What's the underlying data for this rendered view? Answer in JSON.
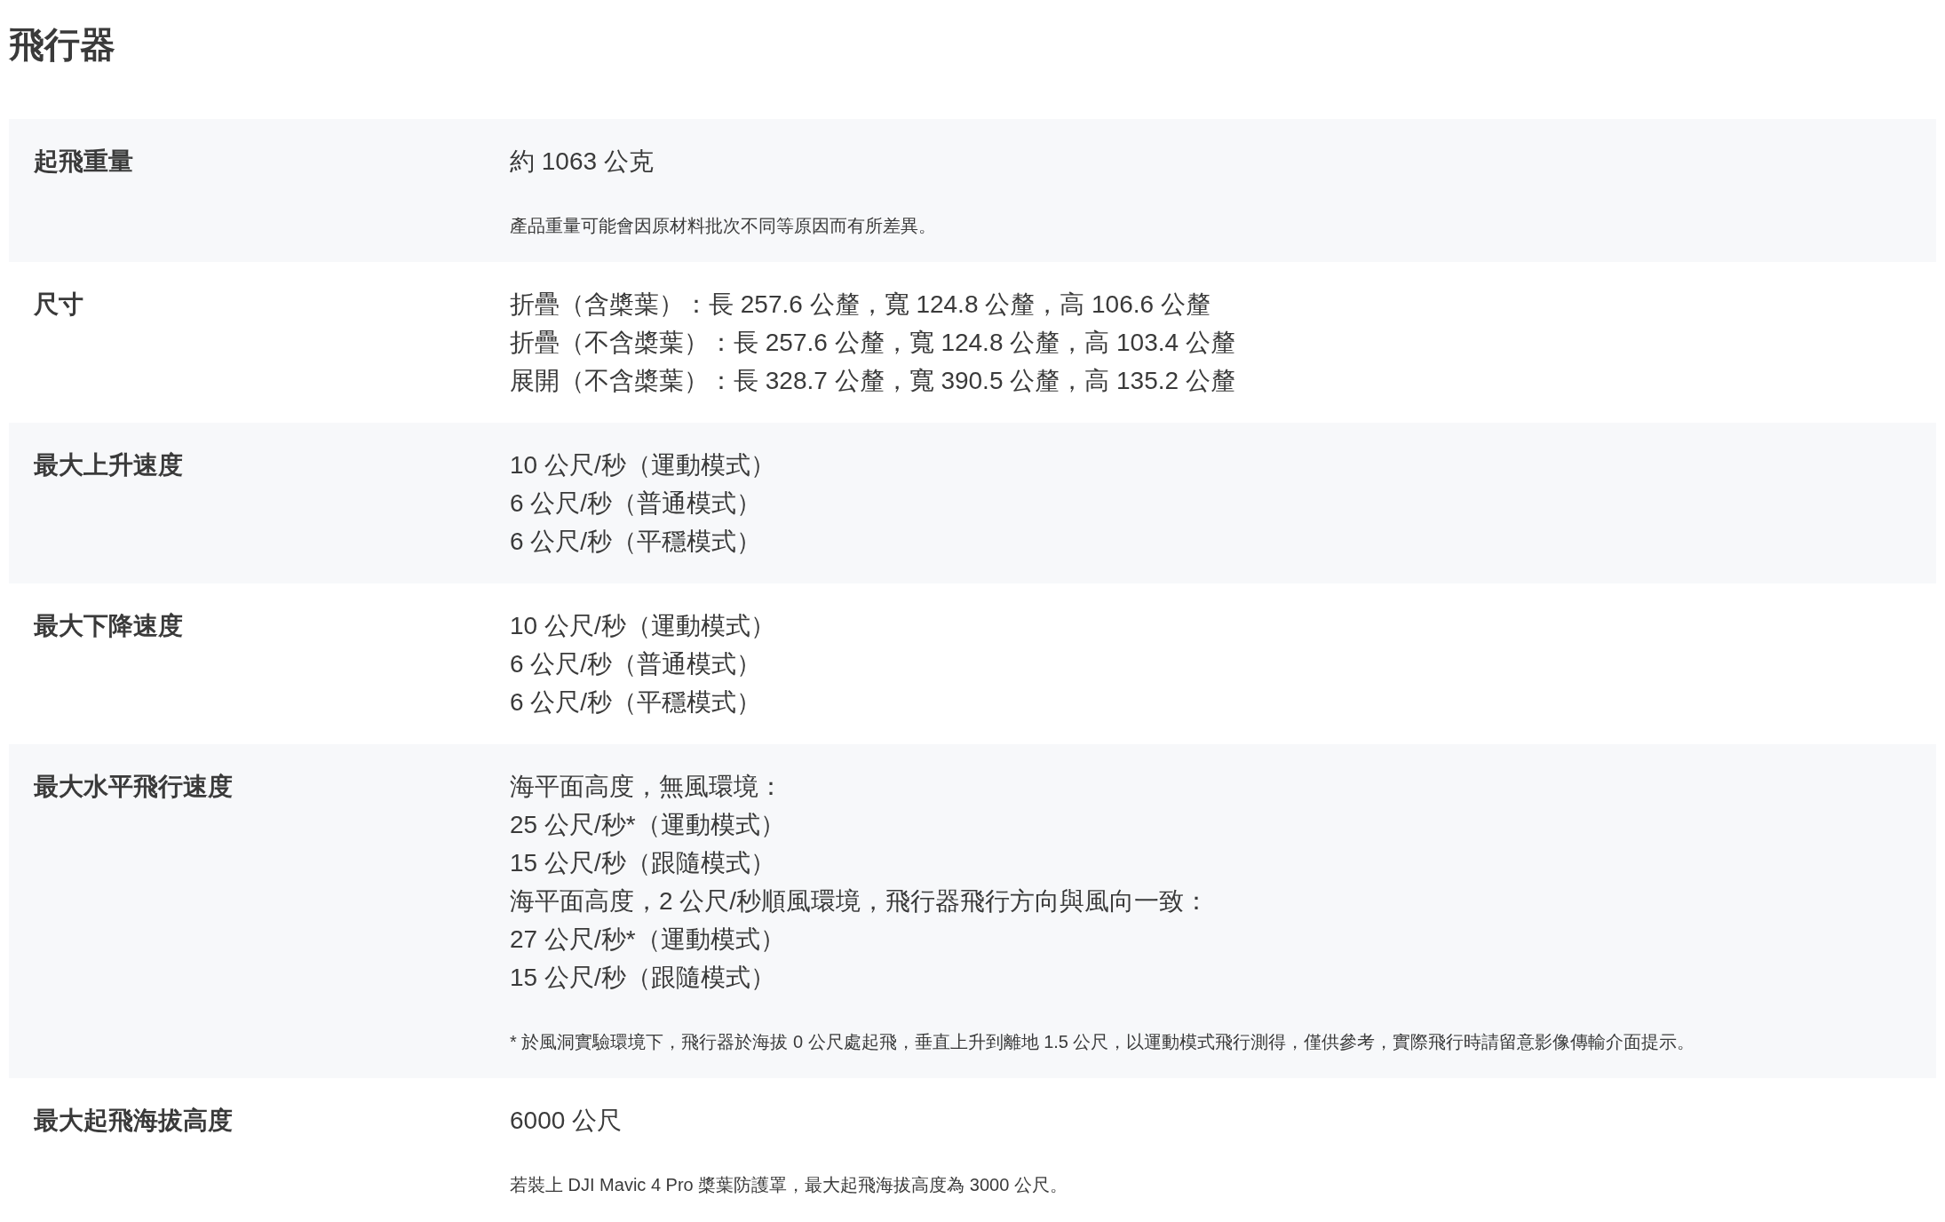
{
  "title": "飛行器",
  "specs": [
    {
      "label": "起飛重量",
      "lines": [
        "約 1063 公克"
      ],
      "note": "產品重量可能會因原材料批次不同等原因而有所差異。"
    },
    {
      "label": "尺寸",
      "lines": [
        "折疊（含槳葉）：長 257.6 公釐，寬 124.8 公釐，高 106.6 公釐",
        "折疊（不含槳葉）：長 257.6 公釐，寬 124.8 公釐，高 103.4 公釐",
        "展開（不含槳葉）：長 328.7 公釐，寬 390.5 公釐，高 135.2 公釐"
      ]
    },
    {
      "label": "最大上升速度",
      "lines": [
        "10 公尺/秒（運動模式）",
        "6 公尺/秒（普通模式）",
        "6 公尺/秒（平穩模式）"
      ]
    },
    {
      "label": "最大下降速度",
      "lines": [
        "10 公尺/秒（運動模式）",
        "6 公尺/秒（普通模式）",
        "6 公尺/秒（平穩模式）"
      ]
    },
    {
      "label": "最大水平飛行速度",
      "lines": [
        "海平面高度，無風環境：",
        "25 公尺/秒*（運動模式）",
        "15 公尺/秒（跟隨模式）",
        "海平面高度，2 公尺/秒順風環境，飛行器飛行方向與風向一致：",
        "27 公尺/秒*（運動模式）",
        "15 公尺/秒（跟隨模式）"
      ],
      "note": "* 於風洞實驗環境下，飛行器於海拔 0 公尺處起飛，垂直上升到離地 1.5 公尺，以運動模式飛行測得，僅供參考，實際飛行時請留意影像傳輸介面提示。"
    },
    {
      "label": "最大起飛海拔高度",
      "lines": [
        "6000 公尺"
      ],
      "note": "若裝上 DJI Mavic 4 Pro 槳葉防護罩，最大起飛海拔高度為 3000 公尺。"
    }
  ]
}
